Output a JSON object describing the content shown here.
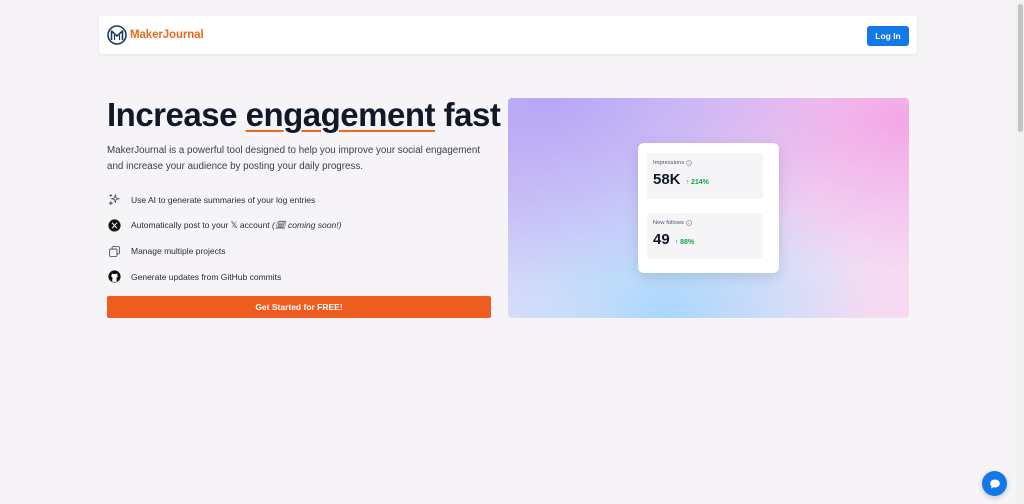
{
  "navbar": {
    "brand_name": "MakerJournal",
    "login_label": "Log In"
  },
  "hero": {
    "title_before": "Increase ",
    "title_accent": "engagement",
    "title_after": " fast",
    "description": "MakerJournal is a powerful tool designed to help you improve your social engagement and increase your audience by posting your daily progress.",
    "features": [
      {
        "icon": "sparkles-icon",
        "text": "Use AI to generate summaries of your log entries"
      },
      {
        "icon": "x-logo-icon",
        "text": "Automatically post to your 𝕏 account",
        "note": "(🗓 coming soon!)"
      },
      {
        "icon": "copy-icon",
        "text": "Manage multiple projects"
      },
      {
        "icon": "github-icon",
        "text": "Generate updates from GitHub commits"
      }
    ],
    "cta_label": "Get Started for FREE!"
  },
  "stats": {
    "impressions": {
      "label": "Impressions",
      "value": "58K",
      "change": "↑ 214%"
    },
    "follows": {
      "label": "New follows",
      "value": "49",
      "change": "↑ 88%"
    }
  },
  "colors": {
    "brand": "#ea6a1c",
    "primary": "#1479e8",
    "cta": "#ee5c1f",
    "positive": "#16a34a"
  },
  "chat_fab_icon": "chat-bubble-icon"
}
